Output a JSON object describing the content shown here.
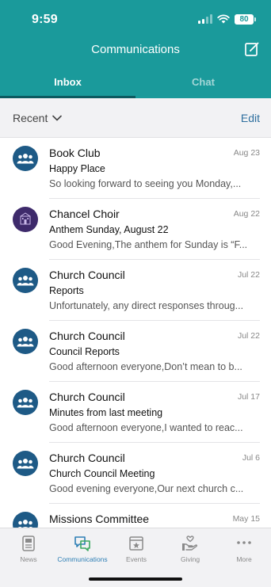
{
  "status_bar": {
    "time": "9:59",
    "battery": "80"
  },
  "header": {
    "title": "Communications",
    "compose_icon": "compose-icon"
  },
  "tabs": [
    {
      "label": "Inbox",
      "active": true
    },
    {
      "label": "Chat",
      "active": false
    }
  ],
  "filter": {
    "label": "Recent",
    "edit_label": "Edit"
  },
  "messages": [
    {
      "sender": "Book Club",
      "date": "Aug 23",
      "subject": "Happy Place",
      "preview": "So looking forward to seeing you Monday,...",
      "avatar": "group-icon"
    },
    {
      "sender": "Chancel Choir",
      "date": "Aug 22",
      "subject": "Anthem Sunday, August 22",
      "preview": "Good Evening,The anthem for Sunday is “F...",
      "avatar": "choir-photo"
    },
    {
      "sender": "Church Council",
      "date": "Jul 22",
      "subject": "Reports",
      "preview": "Unfortunately, any direct responses throug...",
      "avatar": "group-icon"
    },
    {
      "sender": "Church Council",
      "date": "Jul 22",
      "subject": "Council Reports",
      "preview": "Good afternoon everyone,Don’t mean to b...",
      "avatar": "group-icon"
    },
    {
      "sender": "Church Council",
      "date": "Jul 17",
      "subject": "Minutes from last meeting",
      "preview": "Good afternoon everyone,I wanted to reac...",
      "avatar": "group-icon"
    },
    {
      "sender": "Church Council",
      "date": "Jul 6",
      "subject": "Church Council Meeting",
      "preview": "Good evening everyone,Our next church c...",
      "avatar": "group-icon"
    },
    {
      "sender": "Missions Committee",
      "date": "May 15",
      "subject": "",
      "preview": "",
      "avatar": "group-icon"
    }
  ],
  "tabbar": [
    {
      "label": "News",
      "icon": "news-icon",
      "active": false
    },
    {
      "label": "Communications",
      "icon": "chat-bubbles-icon",
      "active": true
    },
    {
      "label": "Events",
      "icon": "calendar-star-icon",
      "active": false
    },
    {
      "label": "Giving",
      "icon": "giving-hand-heart-icon",
      "active": false
    },
    {
      "label": "More",
      "icon": "more-dots-icon",
      "active": false
    }
  ],
  "colors": {
    "header": "#1a9a9b",
    "avatar": "#1e5a86",
    "accent": "#2e7fb5",
    "edit": "#2e6f9e"
  }
}
